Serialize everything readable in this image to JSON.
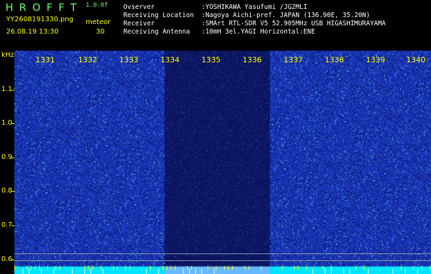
{
  "header": {
    "app_name": "H R O F F T",
    "version": "1.0.0f",
    "filename": "YY2608191330.png",
    "datetime": "26.08.19 13:30",
    "mode_label": "meteor",
    "mode_value": "30",
    "info_labels": [
      "Ovserver",
      "Receiving Location",
      "Receiver",
      "Receiving Antenna"
    ],
    "info_values": [
      ":YOSHIKAWA Yasufumi /JG2MLI",
      ":Nagoya Aichi-pref. JAPAN (136.90E, 35.20N)",
      ":SMArt RTL-SDR V5 52.905MHz USB HIGASHIMURAYAMA",
      ":10mH 3el.YAGI Horizontal:ENE"
    ]
  },
  "axis": {
    "unit": "kHz",
    "y_labels": [
      "1.1",
      "1.0",
      "0.9",
      "0.8",
      "0.7",
      "0.6"
    ],
    "time_labels": [
      "1331",
      "1332",
      "1333",
      "1334",
      "1335",
      "1336",
      "1337",
      "1338",
      "1339",
      "1340"
    ]
  },
  "colors": {
    "background": "#000000",
    "text_yellow": "#ffff00",
    "text_green": "#66ff66",
    "text_white": "#ffffff",
    "spectrum_blue": "#1a2fb0",
    "baseline_cyan": "#00e5ff"
  }
}
